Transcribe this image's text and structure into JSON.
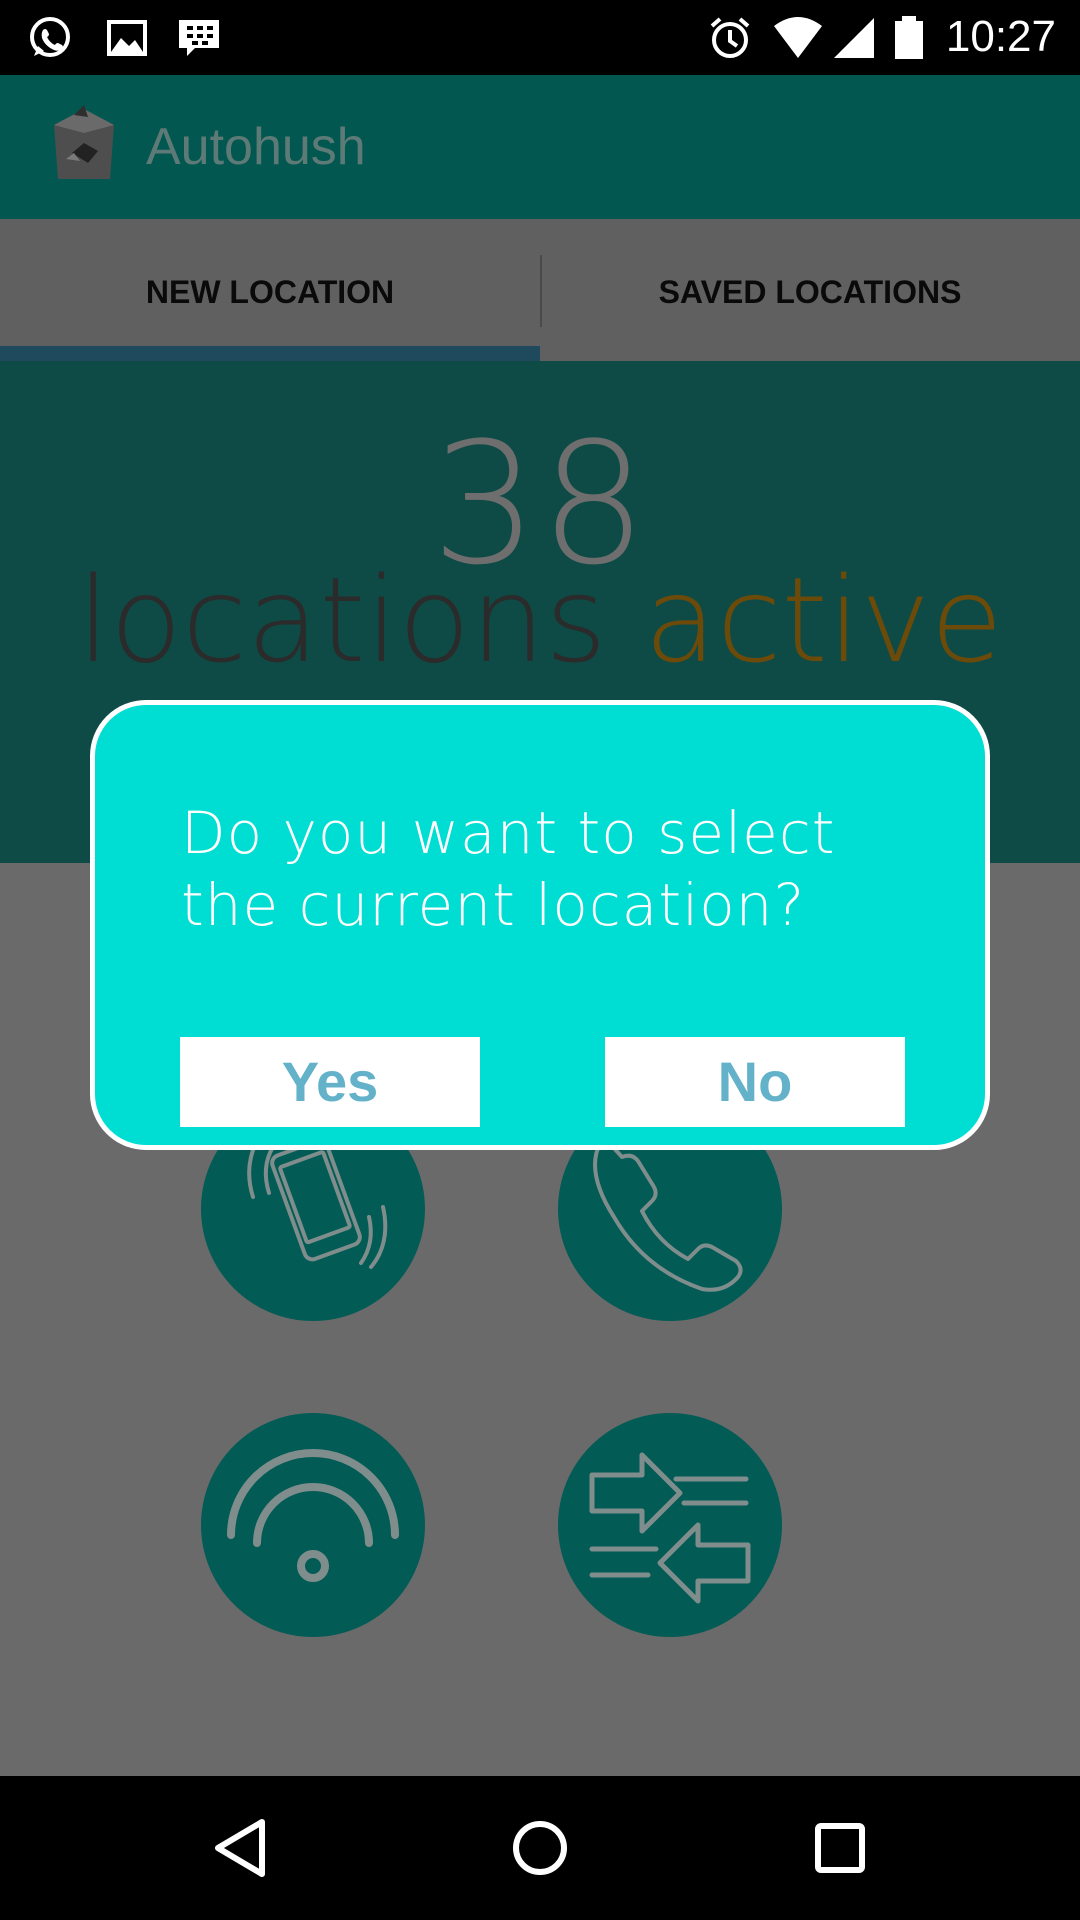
{
  "status_bar": {
    "time": "10:27",
    "left_icons": [
      "whatsapp-icon",
      "gallery-icon",
      "bbm-icon"
    ],
    "right_icons": [
      "alarm-icon",
      "wifi-icon",
      "signal-icon",
      "battery-icon"
    ]
  },
  "app_bar": {
    "title": "Autohush",
    "logo_icon": "app-logo-icon"
  },
  "tabs": [
    {
      "label": "NEW LOCATION",
      "selected": true
    },
    {
      "label": "SAVED LOCATIONS",
      "selected": false
    }
  ],
  "hero": {
    "count": "38",
    "label_word1": "locations",
    "label_word2": "active"
  },
  "mode_buttons": [
    {
      "icon": "vibrate-phone-icon"
    },
    {
      "icon": "phone-icon"
    },
    {
      "icon": "wifi-icon"
    },
    {
      "icon": "sync-arrows-icon"
    }
  ],
  "dialog": {
    "message": "Do you want to select the current location?",
    "yes_label": "Yes",
    "no_label": "No"
  },
  "nav_bar": {
    "icons": [
      "back-icon",
      "home-icon",
      "recents-icon"
    ]
  },
  "colors": {
    "app_bar": "#025750",
    "dialog_bg": "#00ddd3",
    "dialog_button_text": "#63b2c9",
    "circle_fill": "#035b55",
    "tab_indicator": "#1f4a5e",
    "accent_active": "#6b4a0a"
  }
}
